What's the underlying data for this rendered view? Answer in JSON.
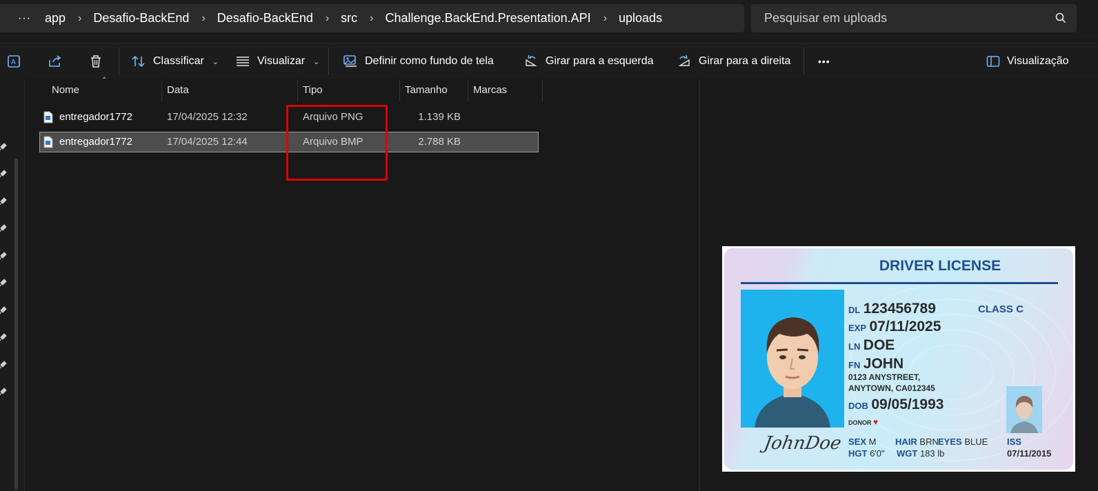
{
  "address": {
    "overflow": "···",
    "segments": [
      "app",
      "Desafio-BackEnd",
      "Desafio-BackEnd",
      "src",
      "Challenge.BackEnd.Presentation.API",
      "uploads"
    ]
  },
  "search": {
    "placeholder": "Pesquisar em uploads"
  },
  "toolbar": {
    "sort_label": "Classificar",
    "view_label": "Visualizar",
    "wallpaper_label": "Definir como fundo de tela",
    "rotate_left_label": "Girar para a esquerda",
    "rotate_right_label": "Girar para a direita",
    "more_label": "•••",
    "preview_label": "Visualização"
  },
  "columns": {
    "name": "Nome",
    "date": "Data",
    "type": "Tipo",
    "size": "Tamanho",
    "tags": "Marcas"
  },
  "files": [
    {
      "name": "entregador1772",
      "date": "17/04/2025 12:32",
      "type": "Arquivo PNG",
      "size": "1.139 KB"
    },
    {
      "name": "entregador1772",
      "date": "17/04/2025 12:44",
      "type": "Arquivo BMP",
      "size": "2.788 KB"
    }
  ],
  "preview": {
    "title": "DRIVER LICENSE",
    "dl_key": "DL",
    "dl_value": "123456789",
    "class_key": "CLASS",
    "class_value": "C",
    "exp_key": "EXP",
    "exp_value": "07/11/2025",
    "ln_key": "LN",
    "ln_value": "DOE",
    "fn_key": "FN",
    "fn_value": "JOHN",
    "address_line1": "0123 ANYSTREET,",
    "address_line2": "ANYTOWN, CA012345",
    "dob_key": "DOB",
    "dob_value": "09/05/1993",
    "donor": "DONOR",
    "sex_key": "SEX",
    "sex_value": "M",
    "hair_key": "HAIR",
    "hair_value": "BRN",
    "eyes_key": "EYES",
    "eyes_value": "BLUE",
    "hgt_key": "HGT",
    "hgt_value": "6'0\"",
    "wgt_key": "WGT",
    "wgt_value": "183 lb",
    "iss_key": "ISS",
    "iss_value": "07/11/2015",
    "signature": "JohnDoe"
  },
  "colors": {
    "highlight": "#e00000",
    "card_blue": "#1f4e8c",
    "photo_bg": "#1fb3ee",
    "selected_row": "#4d4d4d"
  }
}
